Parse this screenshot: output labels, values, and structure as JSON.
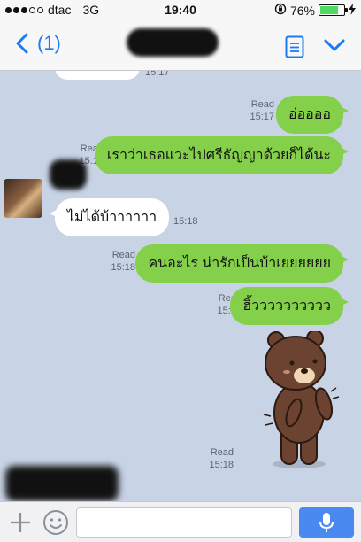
{
  "status_bar": {
    "carrier": "dtac",
    "network": "3G",
    "time": "19:40",
    "battery": "76%",
    "battery_level": 0.76
  },
  "nav": {
    "back_count": "(1)"
  },
  "chat": {
    "top_partial_time": "15:17",
    "messages": [
      {
        "direction": "out",
        "text": "อ่ออออ",
        "read": "Read",
        "time": "15:17"
      },
      {
        "direction": "out",
        "text": "เราว่าเธอแวะไปศรีธัญญาด้วยก็ได้นะ",
        "read": "Read",
        "time": "15:18"
      },
      {
        "direction": "in",
        "text": "ไม่ได้บ้าาาาาา",
        "time": "15:18"
      },
      {
        "direction": "out",
        "text": "คนอะไร น่ารักเป็นบ้าเยยยยยย",
        "read": "Read",
        "time": "15:18"
      },
      {
        "direction": "out",
        "text": "ฮิ้วววววววววว",
        "read": "Read",
        "time": "15:18"
      },
      {
        "direction": "out",
        "sticker": "brown-bear-sticker",
        "read": "Read",
        "time": "15:18"
      }
    ]
  },
  "input_bar": {
    "placeholder": ""
  },
  "colors": {
    "outgoing_bubble": "#85d04b",
    "incoming_bubble": "#ffffff",
    "chat_background": "#c8d4e6",
    "accent": "#1a7cf5",
    "mic_button": "#4a8af0"
  }
}
